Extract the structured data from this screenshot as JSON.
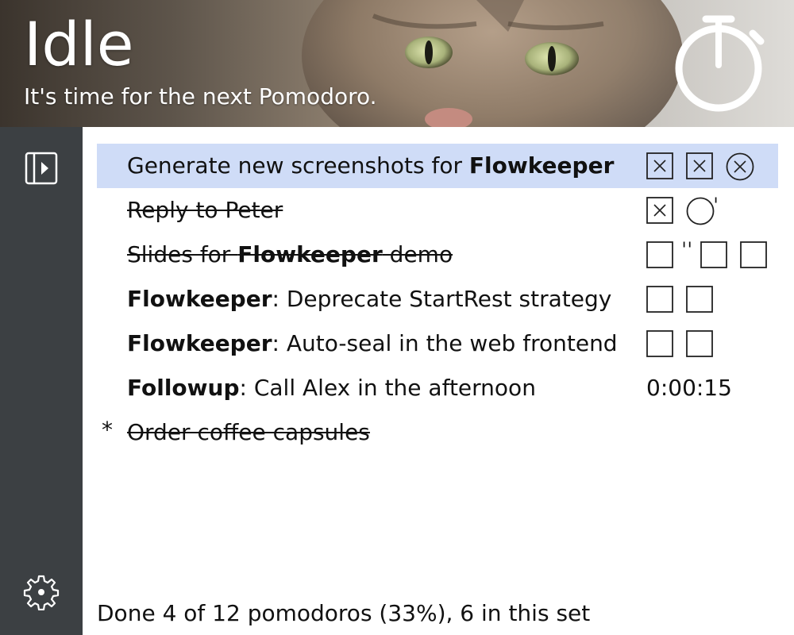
{
  "header": {
    "title": "Idle",
    "subtitle": "It's time for the next Pomodoro."
  },
  "sidebar": {
    "toggle_icon": "sidebar-toggle-icon",
    "settings_icon": "gear-icon"
  },
  "tasks": [
    {
      "parts": [
        "Generate new screenshots for ",
        "Flowkeeper",
        ""
      ],
      "done": false,
      "selected": true,
      "pomodoros": [
        "x-square",
        "x-square",
        "x-circle"
      ]
    },
    {
      "parts": [
        "Reply to Peter",
        "",
        ""
      ],
      "done": true,
      "pomodoros": [
        "x-square",
        "circle",
        "tick"
      ]
    },
    {
      "parts": [
        "Slides for ",
        "Flowkeeper",
        " demo"
      ],
      "done": true,
      "pomodoros": [
        "square",
        "tick2",
        "square",
        "square"
      ]
    },
    {
      "parts": [
        "",
        "Flowkeeper",
        ": Deprecate StartRest strategy"
      ],
      "done": false,
      "pomodoros": [
        "square",
        "square"
      ]
    },
    {
      "parts": [
        "",
        "Flowkeeper",
        ": Auto-seal in the web frontend"
      ],
      "done": false,
      "pomodoros": [
        "square",
        "square"
      ]
    },
    {
      "parts": [
        "",
        "Followup",
        ": Call Alex in the afternoon"
      ],
      "done": false,
      "timer": "0:00:15"
    },
    {
      "parts": [
        "Order coffee capsules",
        "",
        ""
      ],
      "done": true,
      "starred": true,
      "bullet": "*"
    }
  ],
  "status": "Done 4 of 12 pomodoros (33%), 6 in this set"
}
